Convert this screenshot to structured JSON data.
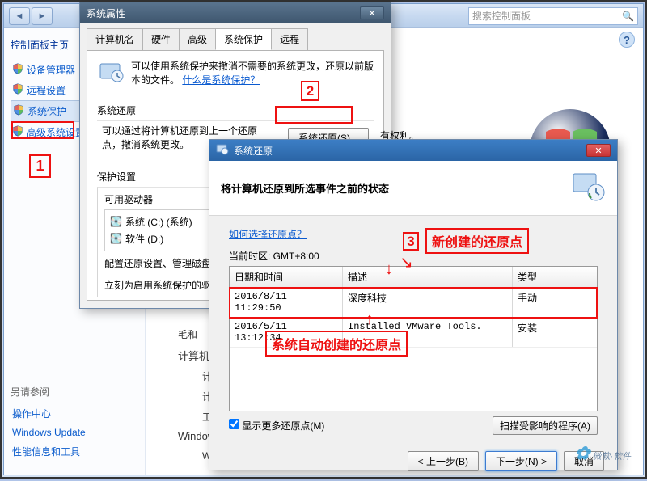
{
  "cp": {
    "search_placeholder": "搜索控制面板",
    "home": "控制面板主页",
    "items": [
      {
        "label": "设备管理器"
      },
      {
        "label": "远程设置"
      },
      {
        "label": "系统保护"
      },
      {
        "label": "高级系统设置"
      }
    ],
    "see_also_heading": "另请参阅",
    "see_also": [
      {
        "label": "操作中心"
      },
      {
        "label": "Windows Update"
      },
      {
        "label": "性能信息和工具"
      }
    ],
    "main": {
      "row1_label": "毛和",
      "row2_label": "计算机名",
      "row3_label": "计",
      "row4_label": "计",
      "row5_label": "工",
      "activation_heading": "Windows",
      "activated": "Windows 已激活"
    }
  },
  "sysprops": {
    "title": "系统属性",
    "tabs": [
      "计算机名",
      "硬件",
      "高级",
      "系统保护",
      "远程"
    ],
    "active_tab": 3,
    "desc1": "可以使用系统保护来撤消不需要的系统更改，还原以前版本的文件。",
    "desc_link": "什么是系统保护？",
    "section_restore_title": "系统还原",
    "restore_desc": "可以通过将计算机还原到上一个还原点，撤消系统更改。",
    "restore_btn": "系统还原(S)...",
    "note_rights": "有权利。",
    "section_protect_title": "保护设置",
    "drives_heading": "可用驱动器",
    "drives": [
      "系统 (C:) (系统)",
      "软件 (D:)"
    ],
    "cfg_desc": "配置还原设置、管理磁盘…原点。",
    "apply_desc": "立刻为启用系统保护的驱…"
  },
  "restore": {
    "title": "系统还原",
    "heading": "将计算机还原到所选事件之前的状态",
    "howto_link": "如何选择还原点？",
    "tz_label": "当前时区: GMT+8:00",
    "cols": [
      "日期和时间",
      "描述",
      "类型"
    ],
    "rows": [
      {
        "dt": "2016/8/11 11:29:50",
        "desc": "深度科技",
        "type": "手动"
      },
      {
        "dt": "2016/5/11 13:12:34",
        "desc": "Installed VMware Tools.",
        "type": "安装"
      }
    ],
    "show_more": "显示更多还原点(M)",
    "scan_btn": "扫描受影响的程序(A)",
    "back_btn": "< 上一步(B)",
    "next_btn": "下一步(N) >",
    "cancel_btn": "取消"
  },
  "annotations": {
    "n1": "1",
    "n2": "2",
    "n3": "3",
    "label_new": "新创建的还原点",
    "label_auto": "系统自动创建的还原点"
  },
  "watermark": "微软·软件"
}
